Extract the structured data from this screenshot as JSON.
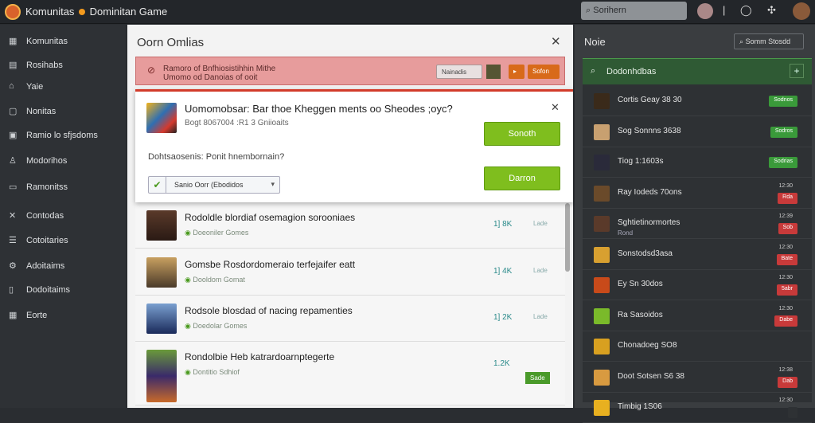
{
  "app": {
    "title": "Komunitas",
    "subtitle": "Dominitan Game"
  },
  "header": {
    "search_placeholder": "Sorihern"
  },
  "sidebar": {
    "items": [
      {
        "label": "Komunitas",
        "icon": "grid-icon"
      },
      {
        "label": "Rosihabs",
        "icon": "list-icon"
      },
      {
        "label": "Yaie",
        "icon": "home-icon"
      },
      {
        "label": "Nonitas",
        "icon": "chat-icon"
      },
      {
        "label": "Ramio lo sfjsdoms",
        "icon": "window-icon"
      },
      {
        "label": "Modorihos",
        "icon": "person-icon"
      },
      {
        "label": "Ramonitss",
        "icon": "doc-icon"
      },
      {
        "label": "Contodas",
        "icon": "tools-icon"
      },
      {
        "label": "Cotoitaries",
        "icon": "table-icon"
      },
      {
        "label": "Adoitaims",
        "icon": "gear-icon"
      },
      {
        "label": "Dodoitaims",
        "icon": "doc-icon"
      },
      {
        "label": "Eorte",
        "icon": "grid-icon"
      }
    ]
  },
  "center": {
    "title": "Oorn Omlias",
    "alert": {
      "text": "Ramoro of Bnfhiosistihhin Mithe\nUmomo od Danoias of ooit",
      "btn1": "Nainadis",
      "btn2": "Sofon"
    },
    "dialog": {
      "title": "Uomomobsar: Bar thoe Kheggen ments oo Sheodes ;oyc?",
      "subtitle": "Bogt 8067004 :R1 3 Gniioaits",
      "question": "Dohtsaosenis: Ponit hnembornain?",
      "select_value": "Sanio Oorr (Ebodidos",
      "btn_primary": "Sonoth",
      "btn_secondary": "Darron"
    },
    "rows": [
      {
        "title": "Rodoldle blordiaf osemagion sorooniaes",
        "meta": "Doeoniler Gomes",
        "num": "1] 8K",
        "act": "Lade"
      },
      {
        "title": "Gomsbe Rosdordomeraio terfejaifer eatt",
        "meta": "Dooldom Gomat",
        "num": "1] 4K",
        "act": "Lade"
      },
      {
        "title": "Rodsole blosdad of nacing repamenties",
        "meta": "Doedolar Gomes",
        "num": "1] 2K",
        "act": "Lade"
      },
      {
        "title": "Rondolbie Heb katrardoarnptegerte",
        "meta": "Dontitio Sdhiof",
        "num": "1.2K",
        "act": "Sade"
      }
    ]
  },
  "right": {
    "title": "Noie",
    "button": "Somm Stosdd",
    "panel_title": "Dodonhdbas",
    "rows": [
      {
        "name": "Cortis Geay 38 30",
        "badge": "Sodnos",
        "badge_color": "#3a9a3a"
      },
      {
        "name": "Sog Sonnns 3638",
        "badge": "Sodros",
        "badge_color": "#3a9a3a"
      },
      {
        "name": "Tiog 1:1603s",
        "badge": "Sodrias",
        "badge_color": "#3a9a3a"
      },
      {
        "name": "Ray Iodeds 70ons",
        "badge": "Rda",
        "badge_color": "#c83a3a",
        "time": "12:30"
      },
      {
        "name": "Sghtietinormortes",
        "sub": "Rond",
        "badge": "Sob",
        "badge_color": "#c83a3a",
        "time": "12:39"
      },
      {
        "name": "Sonstodsd3asa",
        "badge": "Bate",
        "badge_color": "#c83a3a",
        "time": "12:30"
      },
      {
        "name": "Ey Sn 30dos",
        "badge": "5abr",
        "badge_color": "#c83a3a",
        "time": "12:30"
      },
      {
        "name": "Ra Sasoidos",
        "badge": "Dabe",
        "badge_color": "#c83a3a",
        "time": "12:30"
      },
      {
        "name": "Chonadoeg SO8",
        "badge": "",
        "badge_color": "#2e3134"
      },
      {
        "name": "Doot Sotsen S6 38",
        "badge": "Dab",
        "badge_color": "#c83a3a",
        "time": "12:38"
      },
      {
        "name": "Timbig 1S06",
        "badge": "",
        "badge_color": "#2e3134",
        "time": "12:30"
      }
    ]
  }
}
